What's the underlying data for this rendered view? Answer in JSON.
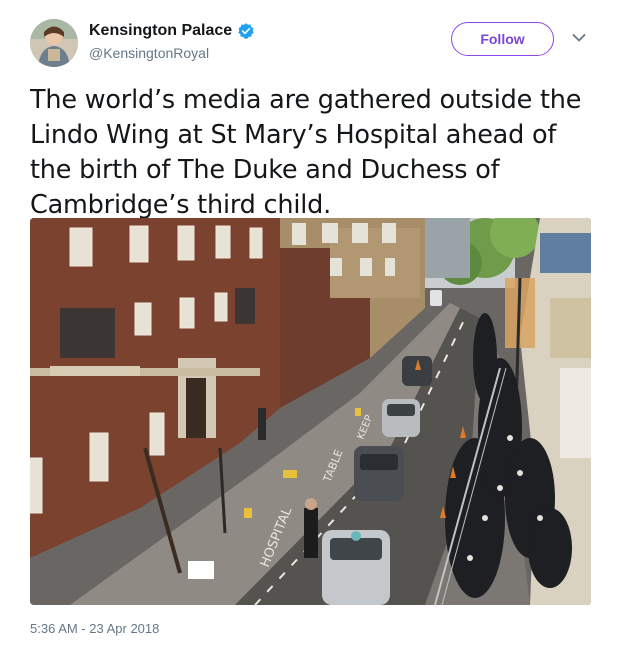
{
  "tweet": {
    "author": {
      "display_name": "Kensington Palace",
      "handle": "@KensingtonRoyal",
      "verified": true,
      "avatar_icon": "avatar-portrait"
    },
    "follow_label": "Follow",
    "menu_icon": "chevron-down-icon",
    "text": "The world’s media are gathered outside the Lindo Wing at St Mary’s Hospital ahead of the birth of The Duke and Duchess of Cambridge’s third child.",
    "media": {
      "icon": "street-photo",
      "road_markings": [
        "HOSPITAL",
        "TABLE",
        "KEEP"
      ]
    },
    "timestamp": "5:36 AM - 23 Apr 2018"
  },
  "colors": {
    "follow_accent": "#7d45d6",
    "verified_blue": "#1da1f2",
    "muted_text": "#657786"
  }
}
